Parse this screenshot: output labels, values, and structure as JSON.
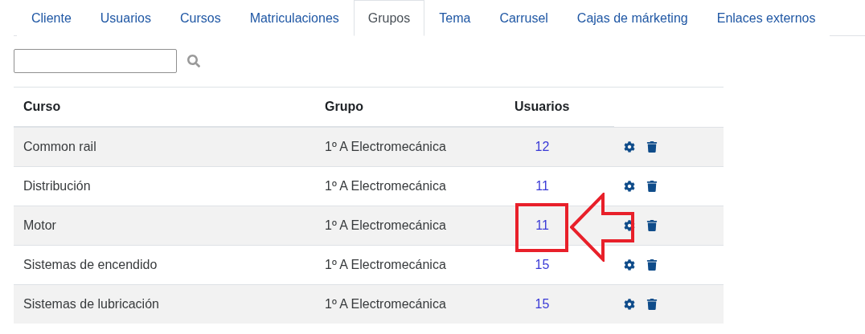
{
  "tabs": [
    {
      "label": "Cliente",
      "selected": false
    },
    {
      "label": "Usuarios",
      "selected": false
    },
    {
      "label": "Cursos",
      "selected": false
    },
    {
      "label": "Matriculaciones",
      "selected": false
    },
    {
      "label": "Grupos",
      "selected": true
    },
    {
      "label": "Tema",
      "selected": false
    },
    {
      "label": "Carrusel",
      "selected": false
    },
    {
      "label": "Cajas de márketing",
      "selected": false
    },
    {
      "label": "Enlaces externos",
      "selected": false
    }
  ],
  "table": {
    "columns": [
      "Curso",
      "Grupo",
      "Usuarios"
    ],
    "rows": [
      {
        "curso": "Common rail",
        "grupo": "1º A Electromecánica",
        "usuarios": "12",
        "highlighted": false
      },
      {
        "curso": "Distribución",
        "grupo": "1º A Electromecánica",
        "usuarios": "11",
        "highlighted": false
      },
      {
        "curso": "Motor",
        "grupo": "1º A Electromecánica",
        "usuarios": "11",
        "highlighted": true
      },
      {
        "curso": "Sistemas de encendido",
        "grupo": "1º A Electromecánica",
        "usuarios": "15",
        "highlighted": false
      },
      {
        "curso": "Sistemas de lubricación",
        "grupo": "1º A Electromecánica",
        "usuarios": "15",
        "highlighted": false
      }
    ]
  }
}
